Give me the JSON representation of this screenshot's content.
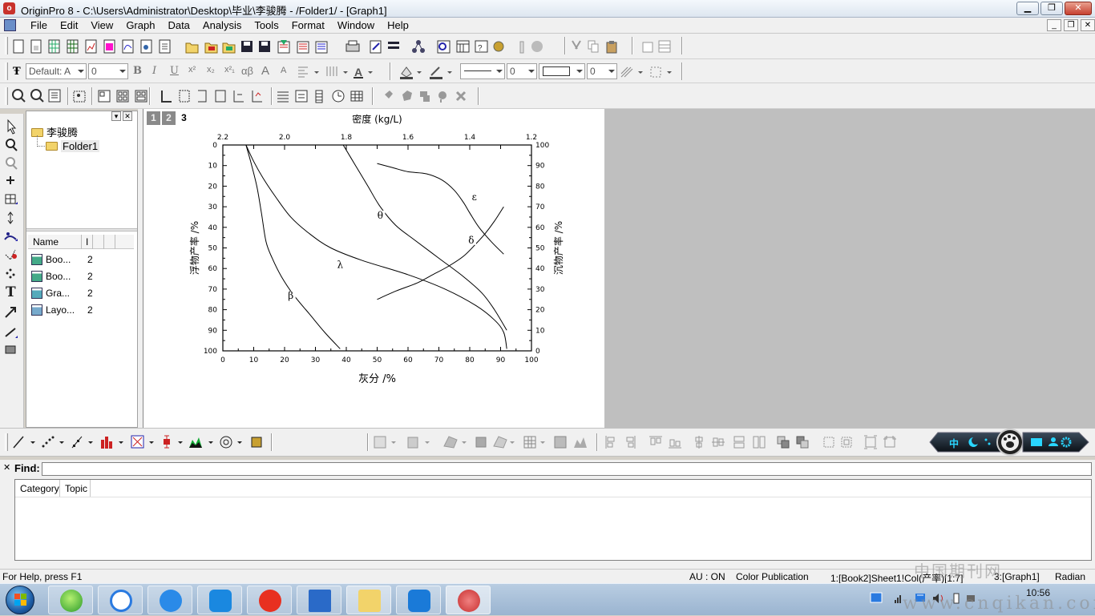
{
  "window": {
    "title": "OriginPro 8 - C:\\Users\\Administrator\\Desktop\\毕业\\李骏腾 - /Folder1/ - [Graph1]"
  },
  "menu": [
    "File",
    "Edit",
    "View",
    "Graph",
    "Data",
    "Analysis",
    "Tools",
    "Format",
    "Window",
    "Help"
  ],
  "format_toolbar": {
    "font": "Default: A",
    "font_size": "0",
    "line_width": "0",
    "fill_value": "0",
    "bold": "B",
    "italic": "I",
    "underline": "U",
    "superscript": "x²",
    "subscript": "x₂",
    "supsub": "x²₁",
    "greek": "αβ",
    "font_up": "A",
    "font_down": "A"
  },
  "project_explorer": {
    "root": "李骏腾",
    "folder": "Folder1",
    "columns": [
      "Name",
      "I"
    ],
    "items": [
      {
        "name": "Boo...",
        "type": "book",
        "col": "2"
      },
      {
        "name": "Boo...",
        "type": "book",
        "col": "2"
      },
      {
        "name": "Gra...",
        "type": "graph",
        "col": "2"
      },
      {
        "name": "Layo...",
        "type": "layout",
        "col": "2"
      }
    ]
  },
  "graph": {
    "layers": [
      "1",
      "2",
      "3"
    ],
    "active_layer": "3"
  },
  "chart_data": {
    "type": "line",
    "xlabel": "灰分 /%",
    "ylabel_left": "浮物产率 /%",
    "ylabel_right": "沉物产率 /%",
    "top_label": "密度 (kg/L)",
    "xlim": [
      0,
      100
    ],
    "ylim_left": [
      0,
      100
    ],
    "ylim_left_inverted": true,
    "ylim_right": [
      0,
      100
    ],
    "top_axis": {
      "ticks": [
        "2.2",
        "2.0",
        "1.8",
        "1.6",
        "1.4",
        "1.2"
      ],
      "range": [
        2.2,
        1.2
      ]
    },
    "x_ticks": [
      "0",
      "10",
      "20",
      "30",
      "40",
      "50",
      "60",
      "70",
      "80",
      "90",
      "100"
    ],
    "y_ticks_left": [
      "0",
      "10",
      "20",
      "30",
      "40",
      "50",
      "60",
      "70",
      "80",
      "90",
      "100"
    ],
    "y_ticks_right": [
      "100",
      "90",
      "80",
      "70",
      "60",
      "50",
      "40",
      "30",
      "20",
      "10",
      "0"
    ],
    "series": [
      {
        "name": "λ",
        "label_at": [
          38,
          59
        ],
        "points": [
          [
            7.5,
            0
          ],
          [
            10,
            8
          ],
          [
            13,
            16
          ],
          [
            17,
            25
          ],
          [
            22,
            35
          ],
          [
            28,
            43
          ],
          [
            35,
            50
          ],
          [
            45,
            56
          ],
          [
            60,
            63
          ],
          [
            72,
            70
          ],
          [
            82,
            78
          ],
          [
            88,
            85
          ],
          [
            91,
            91
          ],
          [
            92,
            99
          ]
        ]
      },
      {
        "name": "β",
        "label_at": [
          22,
          74
        ],
        "points": [
          [
            7.5,
            0
          ],
          [
            9,
            8
          ],
          [
            11,
            20
          ],
          [
            12.5,
            33
          ],
          [
            14,
            47
          ],
          [
            16,
            55
          ],
          [
            19,
            64
          ],
          [
            23,
            73
          ],
          [
            28,
            82
          ],
          [
            33,
            91
          ],
          [
            38,
            99
          ]
        ]
      },
      {
        "name": "θ",
        "label_at": [
          51,
          35
        ],
        "points": [
          [
            39,
            0
          ],
          [
            43,
            10
          ],
          [
            47,
            20
          ],
          [
            51,
            30
          ],
          [
            56,
            39
          ],
          [
            62,
            46
          ],
          [
            70,
            55
          ],
          [
            78,
            64
          ],
          [
            84,
            72
          ],
          [
            88,
            80
          ],
          [
            92,
            90
          ]
        ]
      },
      {
        "name": "δ",
        "label_at": [
          80.5,
          47
        ],
        "points": [
          [
            50,
            75
          ],
          [
            56,
            71
          ],
          [
            63,
            67
          ],
          [
            68,
            63
          ],
          [
            73,
            59
          ],
          [
            78,
            54
          ],
          [
            82,
            48
          ],
          [
            85,
            43
          ],
          [
            88,
            37
          ],
          [
            91,
            30
          ]
        ]
      },
      {
        "name": "ε",
        "label_at": [
          81.5,
          26
        ],
        "points": [
          [
            50,
            9
          ],
          [
            55,
            11
          ],
          [
            60,
            13
          ],
          [
            66,
            14
          ],
          [
            71,
            17
          ],
          [
            75,
            22
          ],
          [
            78,
            28
          ],
          [
            80,
            33
          ],
          [
            83,
            40
          ],
          [
            87,
            47
          ],
          [
            91,
            53
          ]
        ]
      }
    ]
  },
  "find_panel": {
    "label": "Find:",
    "columns": [
      "Category",
      "Topic"
    ]
  },
  "status": {
    "help": "For Help, press F1",
    "au": "AU : ON",
    "mode": "Color Publication",
    "sheet": "1:[Book2]Sheet1!Col(产率)[1:7]",
    "graph": "3:[Graph1]",
    "angle": "Radian"
  },
  "taskbar": {
    "time": "10:56",
    "watermark": "中国期刊网",
    "watermark_url": "www.cnqikan.com"
  }
}
